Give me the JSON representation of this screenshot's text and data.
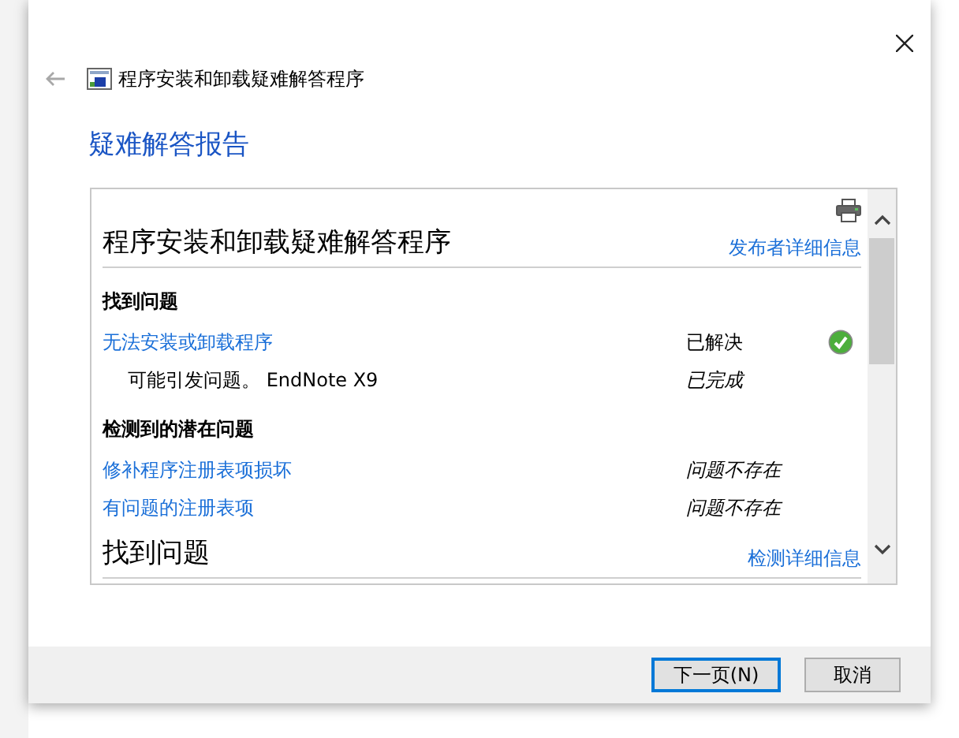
{
  "window": {
    "title": "程序安装和卸载疑难解答程序"
  },
  "heading": "疑难解答报告",
  "report": {
    "title": "程序安装和卸载疑难解答程序",
    "publisher_link": "发布者详细信息",
    "sections": [
      {
        "title": "找到问题",
        "rows": [
          {
            "kind": "link",
            "label": "无法安装或卸载程序",
            "status": "已解决",
            "status_italic": false,
            "resolved": true
          },
          {
            "kind": "text",
            "label": "可能引发问题。 EndNote X9",
            "status": "已完成",
            "status_italic": true,
            "resolved": false
          }
        ]
      },
      {
        "title": "检测到的潜在问题",
        "rows": [
          {
            "kind": "link",
            "label": "修补程序注册表项损坏",
            "status": "问题不存在",
            "status_italic": true,
            "resolved": false
          },
          {
            "kind": "link",
            "label": "有问题的注册表项",
            "status": "问题不存在",
            "status_italic": true,
            "resolved": false
          }
        ]
      }
    ],
    "footer_title": "找到问题",
    "footer_link": "检测详细信息"
  },
  "buttons": [
    {
      "label": "下一页(N)",
      "default": true
    },
    {
      "label": "取消",
      "default": false
    }
  ]
}
